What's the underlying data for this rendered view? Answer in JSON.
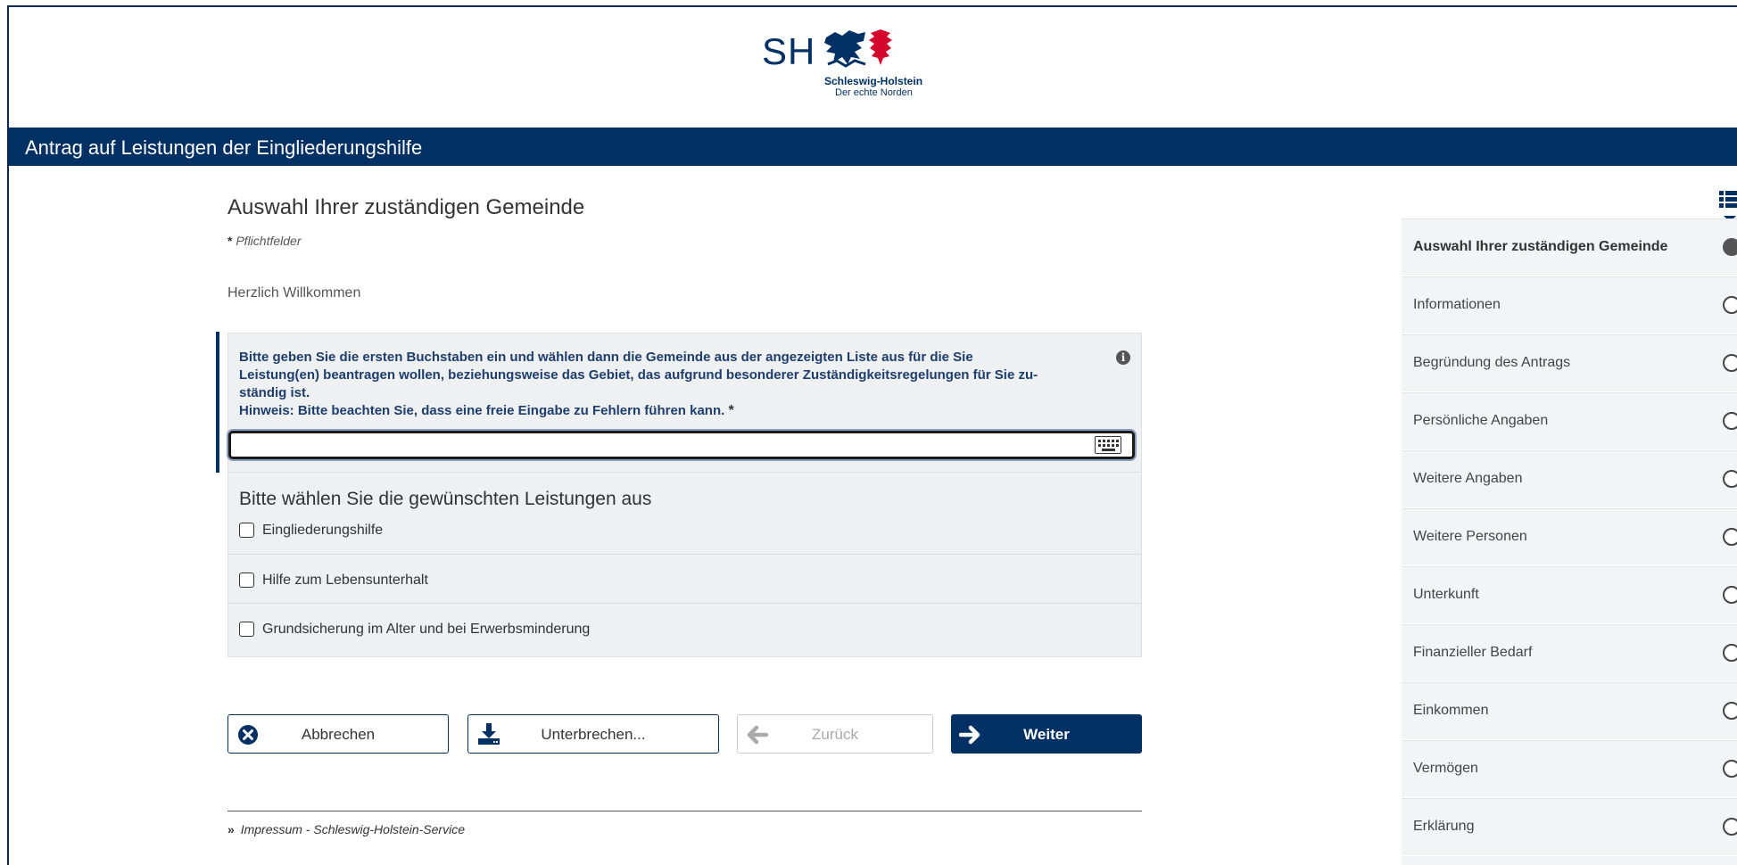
{
  "logo": {
    "abbr": "SH",
    "name": "Schleswig-Holstein",
    "slogan": "Der echte Norden"
  },
  "header": {
    "title": "Antrag auf Leistungen der Eingliederungshilfe"
  },
  "form": {
    "heading": "Auswahl Ihrer zuständigen Gemeinde",
    "required_marker": "*",
    "required_note": "Pflichtfelder",
    "welcome": "Herzlich Willkommen",
    "municipality_field": {
      "label_line1": "Bitte geben Sie die ersten Buchstaben ein und wählen dann die Gemeinde aus der angezeigten Liste aus für die Sie",
      "label_line2": "Leistung(en) beantragen wollen, beziehungsweise das Gebiet, das aufgrund besonderer Zuständigkeitsregelungen für Sie zu-",
      "label_line3": "ständig ist.",
      "label_line4": "Hinweis: Bitte beachten Sie, dass eine freie Eingabe zu Fehlern führen kann.",
      "required_marker": "*",
      "value": ""
    },
    "services": {
      "title": "Bitte wählen Sie die gewünschten Leistungen aus",
      "items": [
        {
          "label": "Eingliederungshilfe",
          "checked": false
        },
        {
          "label": "Hilfe zum Lebensunterhalt",
          "checked": false
        },
        {
          "label": "Grundsicherung im Alter und bei Erwerbsminderung",
          "checked": false
        }
      ]
    }
  },
  "buttons": {
    "cancel": "Abbrechen",
    "pause": "Unterbrechen...",
    "back": "Zurück",
    "next": "Weiter"
  },
  "footer": {
    "link": "Impressum - Schleswig-Holstein-Service"
  },
  "steps": {
    "items": [
      {
        "label": "Auswahl Ihrer zuständigen Gemeinde",
        "active": true
      },
      {
        "label": "Informationen",
        "active": false
      },
      {
        "label": "Begründung des Antrags",
        "active": false
      },
      {
        "label": "Persönliche Angaben",
        "active": false
      },
      {
        "label": "Weitere Angaben",
        "active": false
      },
      {
        "label": "Weitere Personen",
        "active": false
      },
      {
        "label": "Unterkunft",
        "active": false
      },
      {
        "label": "Finanzieller Bedarf",
        "active": false
      },
      {
        "label": "Einkommen",
        "active": false
      },
      {
        "label": "Vermögen",
        "active": false
      },
      {
        "label": "Erklärung",
        "active": false
      }
    ]
  },
  "colors": {
    "brand_navy": "#003064",
    "panel_bg": "#eef0f1",
    "sidebar_bg": "#f2f4f5"
  }
}
